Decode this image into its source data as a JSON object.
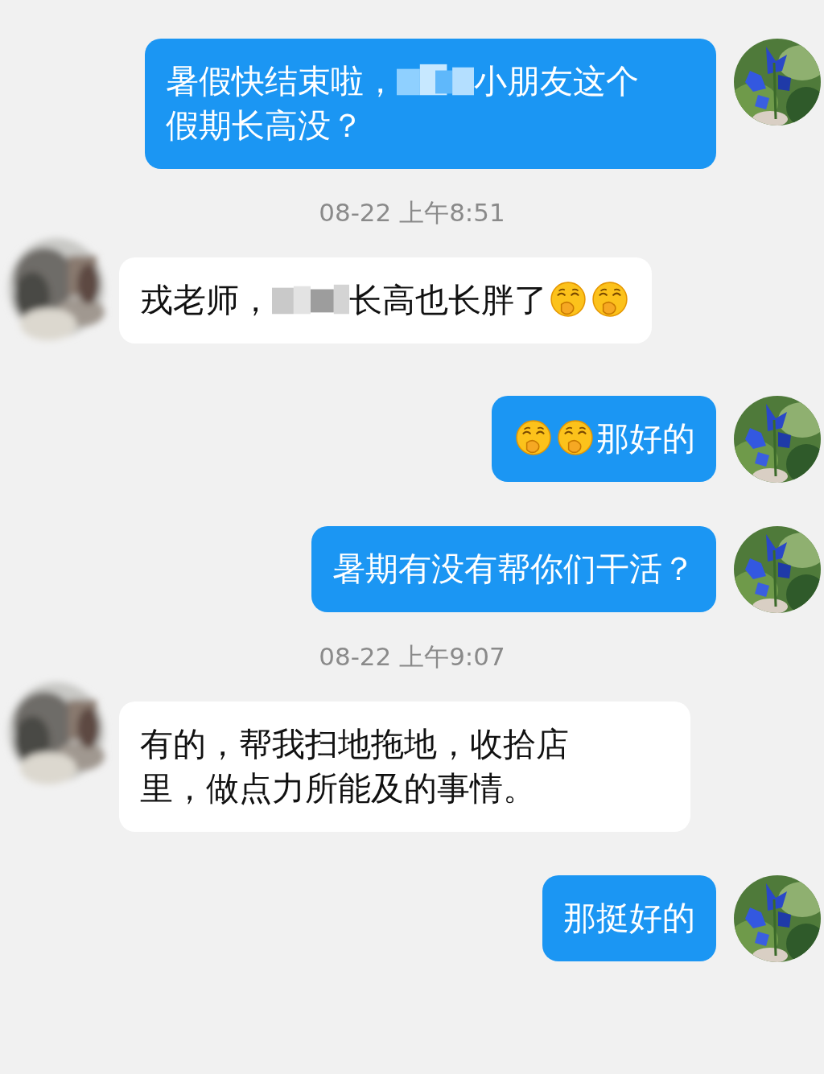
{
  "messages": [
    {
      "kind": "sent",
      "parts": [
        {
          "kind": "text",
          "text": "暑假快结束啦，"
        },
        {
          "kind": "blur"
        },
        {
          "kind": "text",
          "text": "小朋友这个"
        },
        {
          "kind": "text",
          "text": "假期长高没？"
        }
      ]
    },
    {
      "kind": "time",
      "text": "08-22 上午8:51"
    },
    {
      "kind": "received",
      "parts": [
        {
          "kind": "text",
          "text": "戎老师，"
        },
        {
          "kind": "blur"
        },
        {
          "kind": "text",
          "text": "长高也长胖了"
        },
        {
          "kind": "emoji"
        },
        {
          "kind": "emoji"
        }
      ]
    },
    {
      "kind": "sent",
      "parts": [
        {
          "kind": "emoji"
        },
        {
          "kind": "emoji"
        },
        {
          "kind": "text",
          "text": "那好的"
        }
      ]
    },
    {
      "kind": "sent",
      "parts": [
        {
          "kind": "text",
          "text": "暑期有没有帮你们干活？"
        }
      ]
    },
    {
      "kind": "time",
      "text": "08-22 上午9:07"
    },
    {
      "kind": "received",
      "parts": [
        {
          "kind": "text",
          "text": "有的，帮我扫地拖地，收拾店"
        },
        {
          "kind": "text",
          "text": "里，做点力所能及的事情。"
        }
      ]
    },
    {
      "kind": "sent",
      "parts": [
        {
          "kind": "text",
          "text": "那挺好的"
        }
      ]
    }
  ]
}
